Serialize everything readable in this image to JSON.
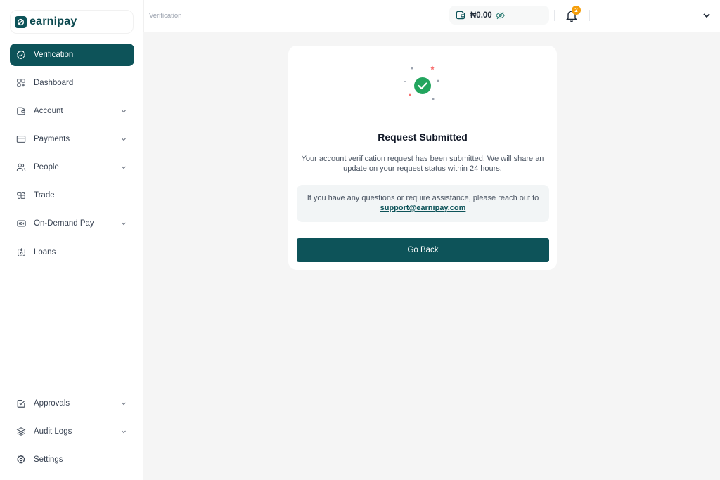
{
  "brand": {
    "name": "earnipay",
    "color": "#0d5359"
  },
  "sidebar": {
    "items": [
      {
        "label": "Verification",
        "icon": "badge-check-icon",
        "active": true,
        "has_chevron": false
      },
      {
        "label": "Dashboard",
        "icon": "dashboard-grid-icon",
        "active": false,
        "has_chevron": false
      },
      {
        "label": "Account",
        "icon": "wallet-icon",
        "active": false,
        "has_chevron": true
      },
      {
        "label": "Payments",
        "icon": "card-icon",
        "active": false,
        "has_chevron": true
      },
      {
        "label": "People",
        "icon": "users-icon",
        "active": false,
        "has_chevron": true
      },
      {
        "label": "Trade",
        "icon": "trade-icon",
        "active": false,
        "has_chevron": false
      },
      {
        "label": "On-Demand Pay",
        "icon": "cash-icon",
        "active": false,
        "has_chevron": true
      },
      {
        "label": "Loans",
        "icon": "loan-icon",
        "active": false,
        "has_chevron": false
      }
    ],
    "bottom_items": [
      {
        "label": "Approvals",
        "icon": "checkbox-icon",
        "has_chevron": true
      },
      {
        "label": "Audit Logs",
        "icon": "layers-icon",
        "has_chevron": true
      },
      {
        "label": "Settings",
        "icon": "gear-icon",
        "has_chevron": false
      }
    ]
  },
  "topbar": {
    "breadcrumb": "Verification",
    "wallet_balance": "₦0.00",
    "notification_count": "2"
  },
  "card": {
    "title": "Request Submitted",
    "description": "Your account verification request has been submitted. We will share an update on your request status within 24 hours.",
    "support_text": "If you have any questions or require assistance, please reach out to",
    "support_email": "support@earnipay.com",
    "button_label": "Go Back"
  }
}
